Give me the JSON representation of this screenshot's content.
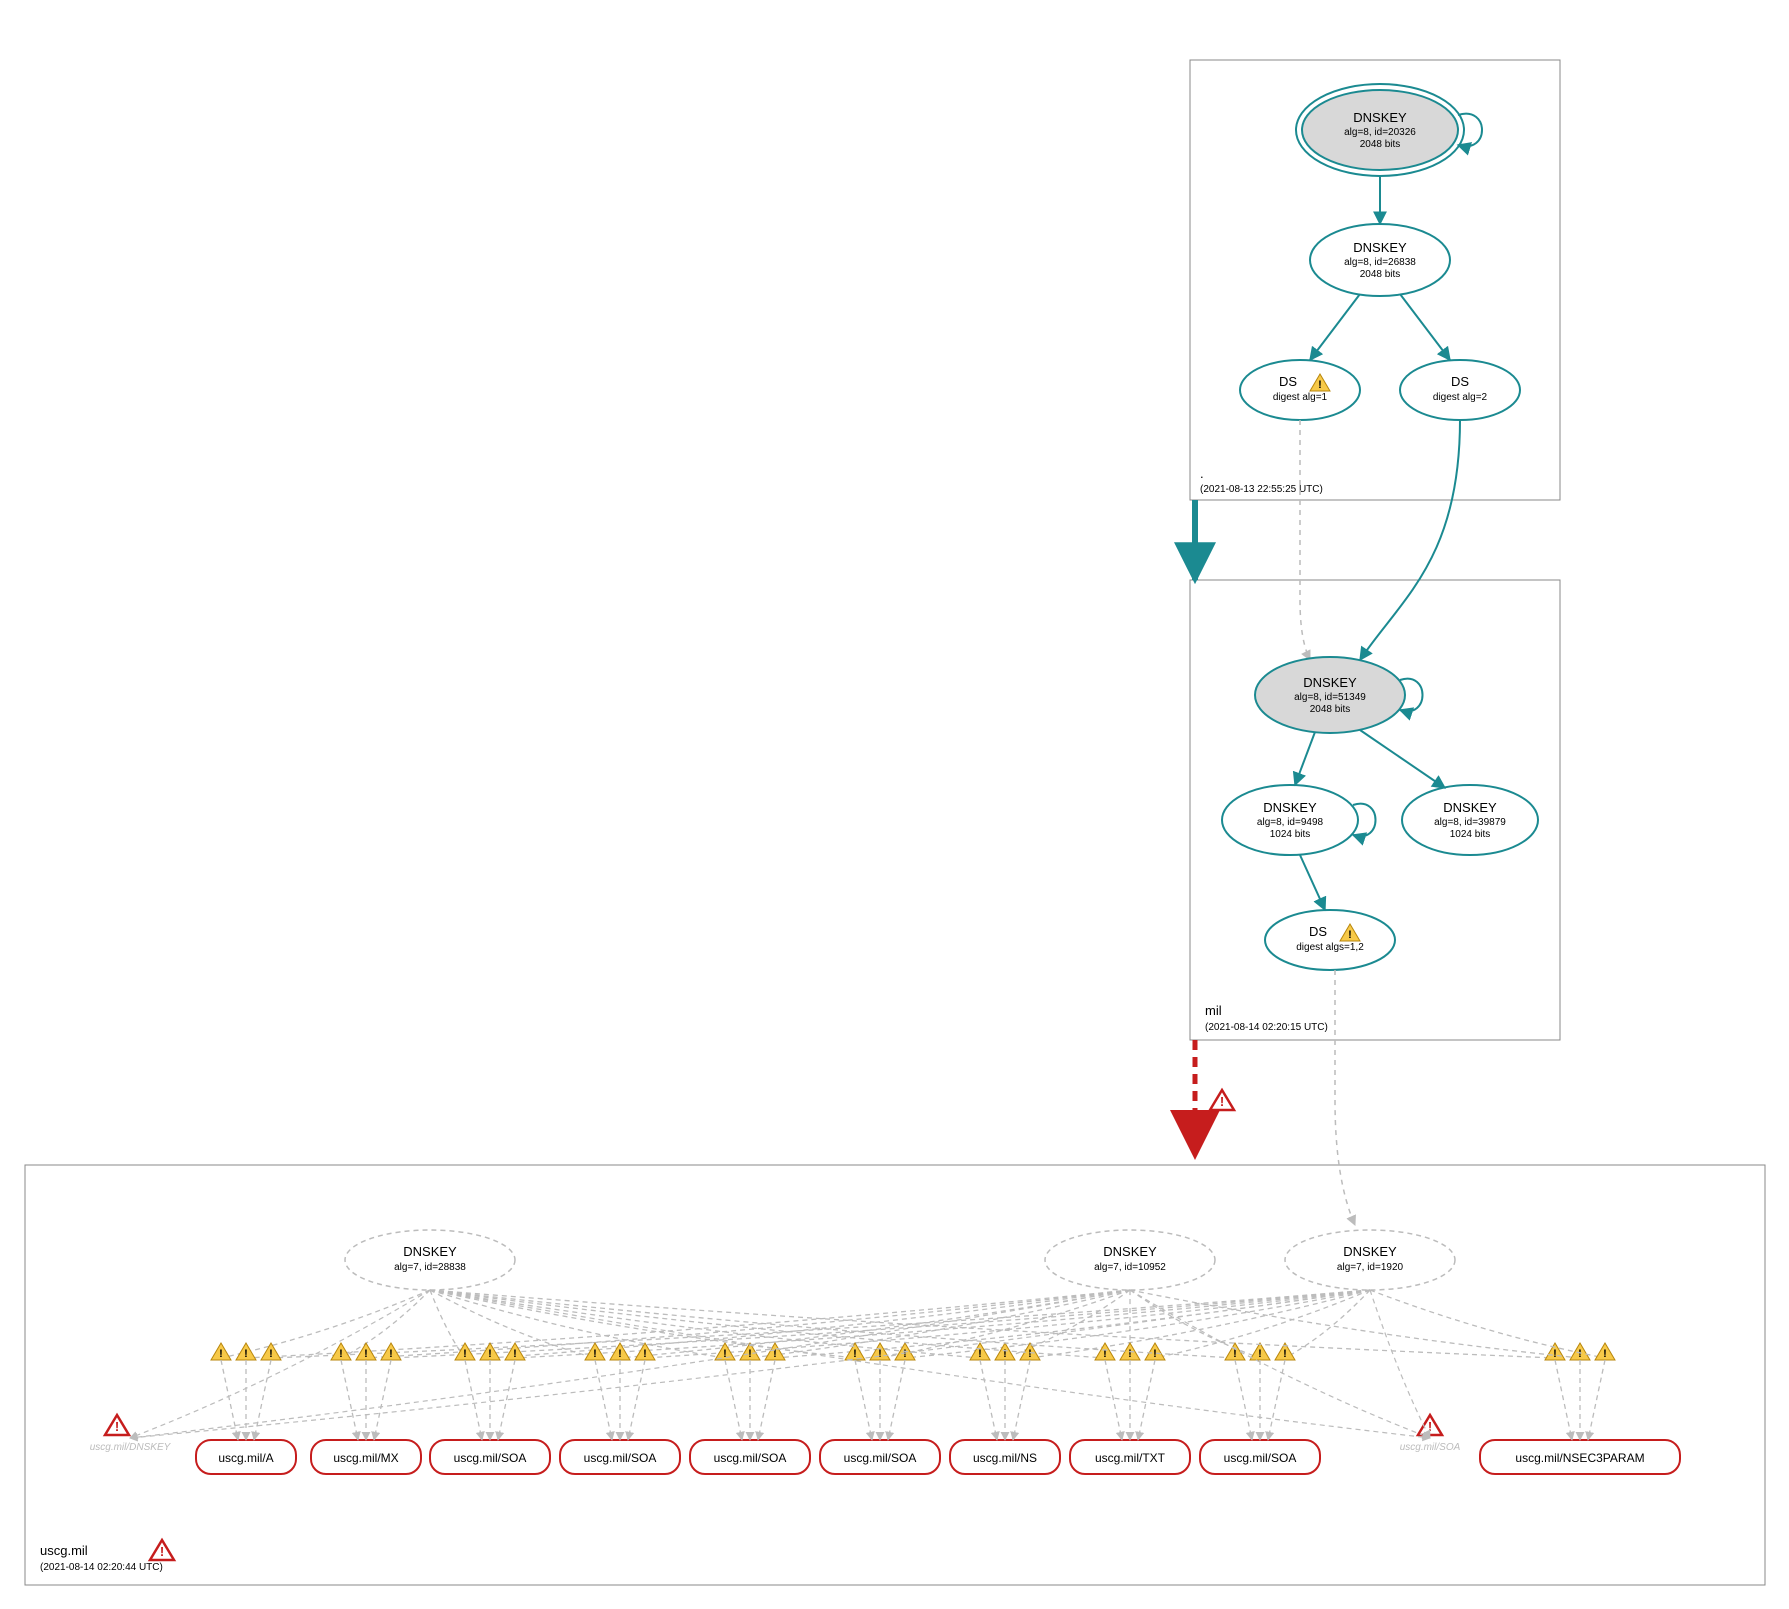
{
  "colors": {
    "teal": "#1b8a91",
    "red": "#c61d1d",
    "grey": "#bcbcbc",
    "greyFill": "#d8d8d8",
    "boxStroke": "#888"
  },
  "zones": {
    "root": {
      "label": ".",
      "time": "(2021-08-13 22:55:25 UTC)"
    },
    "mil": {
      "label": "mil",
      "time": "(2021-08-14 02:20:15 UTC)"
    },
    "uscg": {
      "label": "uscg.mil",
      "time": "(2021-08-14 02:20:44 UTC)"
    }
  },
  "nodes": {
    "rootKsk": {
      "title": "DNSKEY",
      "sub1": "alg=8, id=20326",
      "sub2": "2048 bits"
    },
    "rootZsk": {
      "title": "DNSKEY",
      "sub1": "alg=8, id=26838",
      "sub2": "2048 bits"
    },
    "rootDs1": {
      "title": "DS",
      "sub1": "digest alg=1",
      "warn": true
    },
    "rootDs2": {
      "title": "DS",
      "sub1": "digest alg=2",
      "warn": false
    },
    "milKsk": {
      "title": "DNSKEY",
      "sub1": "alg=8, id=51349",
      "sub2": "2048 bits"
    },
    "milZsk1": {
      "title": "DNSKEY",
      "sub1": "alg=8, id=9498",
      "sub2": "1024 bits"
    },
    "milZsk2": {
      "title": "DNSKEY",
      "sub1": "alg=8, id=39879",
      "sub2": "1024 bits"
    },
    "milDs": {
      "title": "DS",
      "sub1": "digest algs=1,2",
      "warn": true
    },
    "uscgKey1": {
      "title": "DNSKEY",
      "sub1": "alg=7, id=28838"
    },
    "uscgKey2": {
      "title": "DNSKEY",
      "sub1": "alg=7, id=10952"
    },
    "uscgKey3": {
      "title": "DNSKEY",
      "sub1": "alg=7, id=1920"
    }
  },
  "ghosts": {
    "dnskey": "uscg.mil/DNSKEY",
    "soa": "uscg.mil/SOA"
  },
  "rrsets": [
    "uscg.mil/A",
    "uscg.mil/MX",
    "uscg.mil/SOA",
    "uscg.mil/SOA",
    "uscg.mil/SOA",
    "uscg.mil/SOA",
    "uscg.mil/NS",
    "uscg.mil/TXT",
    "uscg.mil/SOA",
    "uscg.mil/NSEC3PARAM"
  ]
}
